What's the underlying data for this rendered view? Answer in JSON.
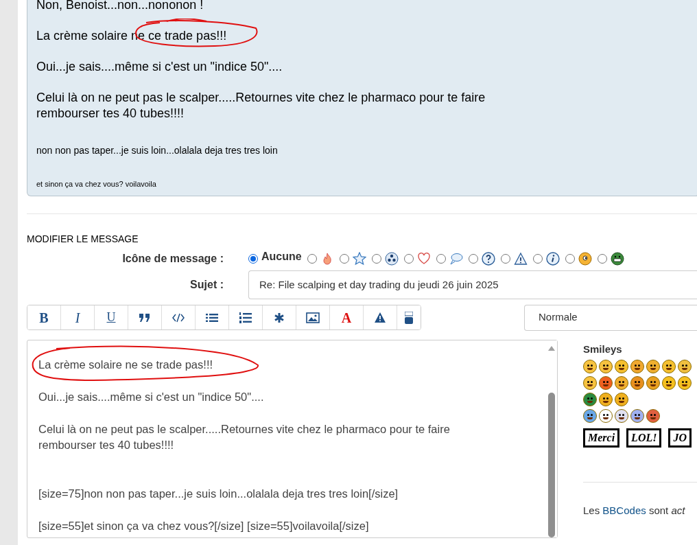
{
  "quote": {
    "paragraphs": [
      {
        "text": "Non, Benoist...non...nononon !",
        "kind": "large"
      },
      {
        "text": "La crème solaire ne ce trade pas!!!",
        "kind": "large",
        "circled": true
      },
      {
        "text": "Oui...je sais....même si c'est un \"indice 50\"....",
        "kind": "large"
      },
      {
        "text": "Celui là on ne peut pas le scalper.....Retournes vite chez le pharmaco pour te faire rembourser tes 40 tubes!!!!",
        "kind": "large"
      },
      {
        "text": "non non pas taper...je suis loin...olalala deja tres tres loin",
        "kind": "small"
      },
      {
        "text": "et sinon ça va chez vous?  voilavoila",
        "kind": "tiny"
      }
    ]
  },
  "form": {
    "title": "MODIFIER LE MESSAGE",
    "icon_label": "Icône de message :",
    "message_icons": [
      {
        "kind": "none",
        "label": "Aucune",
        "selected": true
      },
      {
        "kind": "fire",
        "selected": false
      },
      {
        "kind": "star",
        "selected": false
      },
      {
        "kind": "radioactive",
        "selected": false
      },
      {
        "kind": "heart",
        "selected": false
      },
      {
        "kind": "speech",
        "selected": false
      },
      {
        "kind": "question",
        "selected": false
      },
      {
        "kind": "warning",
        "selected": false
      },
      {
        "kind": "info",
        "selected": false
      },
      {
        "kind": "wink",
        "selected": false
      },
      {
        "kind": "grin",
        "selected": false
      }
    ],
    "subject_label": "Sujet :",
    "subject_value": "Re: File scalping et day trading du jeudi 26 juin 2025",
    "toolbar": [
      {
        "kind": "bold",
        "label": "B"
      },
      {
        "kind": "italic",
        "label": "I"
      },
      {
        "kind": "underline",
        "label": "U"
      },
      {
        "kind": "quote"
      },
      {
        "kind": "code"
      },
      {
        "kind": "list"
      },
      {
        "kind": "olist"
      },
      {
        "kind": "asterisk"
      },
      {
        "kind": "image"
      },
      {
        "kind": "color",
        "label": "A"
      },
      {
        "kind": "warning"
      },
      {
        "kind": "youtube"
      }
    ],
    "font_size": "Normale",
    "editor_paragraphs": [
      {
        "lines": [
          "La crème solaire ne se trade pas!!!"
        ],
        "kind": "spaced",
        "circled": true
      },
      {
        "lines": [
          "Oui...je sais....même si c'est un \"indice 50\"...."
        ],
        "kind": "spaced"
      },
      {
        "lines": [
          "Celui là on ne peut pas le scalper.....Retournes vite chez le pharmaco pour te faire",
          "rembourser tes 40 tubes!!!!"
        ],
        "kind": "double_spaced"
      },
      {
        "lines": [
          "[size=75]non non pas taper...je suis loin...olalala deja tres tres loin[/size]"
        ],
        "kind": "spaced"
      },
      {
        "lines": [
          "[size=55]et sinon ça va chez vous?[/size] [size=55]voilavoila[/size]"
        ]
      }
    ],
    "smileys": {
      "title": "Smileys",
      "signs": [
        "Merci",
        "LOL!",
        "JO"
      ]
    },
    "bbcode_note": {
      "before": "Les",
      "link": "BBCodes",
      "after": "sont *act*"
    }
  }
}
